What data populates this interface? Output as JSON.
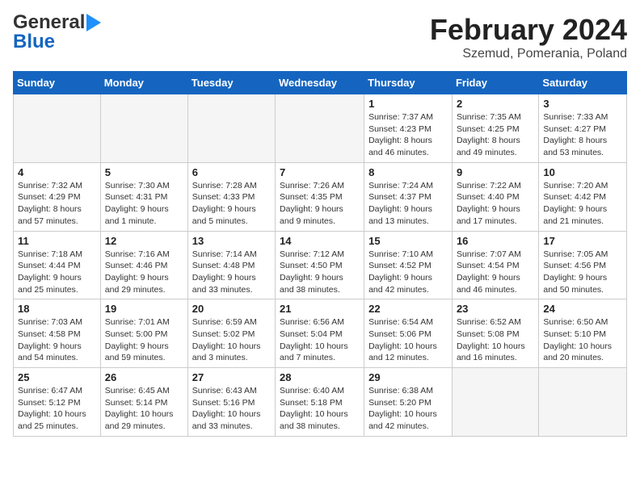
{
  "header": {
    "logo_general": "General",
    "logo_blue": "Blue",
    "month_title": "February 2024",
    "subtitle": "Szemud, Pomerania, Poland"
  },
  "days_of_week": [
    "Sunday",
    "Monday",
    "Tuesday",
    "Wednesday",
    "Thursday",
    "Friday",
    "Saturday"
  ],
  "weeks": [
    [
      {
        "day": "",
        "info": ""
      },
      {
        "day": "",
        "info": ""
      },
      {
        "day": "",
        "info": ""
      },
      {
        "day": "",
        "info": ""
      },
      {
        "day": "1",
        "info": "Sunrise: 7:37 AM\nSunset: 4:23 PM\nDaylight: 8 hours\nand 46 minutes."
      },
      {
        "day": "2",
        "info": "Sunrise: 7:35 AM\nSunset: 4:25 PM\nDaylight: 8 hours\nand 49 minutes."
      },
      {
        "day": "3",
        "info": "Sunrise: 7:33 AM\nSunset: 4:27 PM\nDaylight: 8 hours\nand 53 minutes."
      }
    ],
    [
      {
        "day": "4",
        "info": "Sunrise: 7:32 AM\nSunset: 4:29 PM\nDaylight: 8 hours\nand 57 minutes."
      },
      {
        "day": "5",
        "info": "Sunrise: 7:30 AM\nSunset: 4:31 PM\nDaylight: 9 hours\nand 1 minute."
      },
      {
        "day": "6",
        "info": "Sunrise: 7:28 AM\nSunset: 4:33 PM\nDaylight: 9 hours\nand 5 minutes."
      },
      {
        "day": "7",
        "info": "Sunrise: 7:26 AM\nSunset: 4:35 PM\nDaylight: 9 hours\nand 9 minutes."
      },
      {
        "day": "8",
        "info": "Sunrise: 7:24 AM\nSunset: 4:37 PM\nDaylight: 9 hours\nand 13 minutes."
      },
      {
        "day": "9",
        "info": "Sunrise: 7:22 AM\nSunset: 4:40 PM\nDaylight: 9 hours\nand 17 minutes."
      },
      {
        "day": "10",
        "info": "Sunrise: 7:20 AM\nSunset: 4:42 PM\nDaylight: 9 hours\nand 21 minutes."
      }
    ],
    [
      {
        "day": "11",
        "info": "Sunrise: 7:18 AM\nSunset: 4:44 PM\nDaylight: 9 hours\nand 25 minutes."
      },
      {
        "day": "12",
        "info": "Sunrise: 7:16 AM\nSunset: 4:46 PM\nDaylight: 9 hours\nand 29 minutes."
      },
      {
        "day": "13",
        "info": "Sunrise: 7:14 AM\nSunset: 4:48 PM\nDaylight: 9 hours\nand 33 minutes."
      },
      {
        "day": "14",
        "info": "Sunrise: 7:12 AM\nSunset: 4:50 PM\nDaylight: 9 hours\nand 38 minutes."
      },
      {
        "day": "15",
        "info": "Sunrise: 7:10 AM\nSunset: 4:52 PM\nDaylight: 9 hours\nand 42 minutes."
      },
      {
        "day": "16",
        "info": "Sunrise: 7:07 AM\nSunset: 4:54 PM\nDaylight: 9 hours\nand 46 minutes."
      },
      {
        "day": "17",
        "info": "Sunrise: 7:05 AM\nSunset: 4:56 PM\nDaylight: 9 hours\nand 50 minutes."
      }
    ],
    [
      {
        "day": "18",
        "info": "Sunrise: 7:03 AM\nSunset: 4:58 PM\nDaylight: 9 hours\nand 54 minutes."
      },
      {
        "day": "19",
        "info": "Sunrise: 7:01 AM\nSunset: 5:00 PM\nDaylight: 9 hours\nand 59 minutes."
      },
      {
        "day": "20",
        "info": "Sunrise: 6:59 AM\nSunset: 5:02 PM\nDaylight: 10 hours\nand 3 minutes."
      },
      {
        "day": "21",
        "info": "Sunrise: 6:56 AM\nSunset: 5:04 PM\nDaylight: 10 hours\nand 7 minutes."
      },
      {
        "day": "22",
        "info": "Sunrise: 6:54 AM\nSunset: 5:06 PM\nDaylight: 10 hours\nand 12 minutes."
      },
      {
        "day": "23",
        "info": "Sunrise: 6:52 AM\nSunset: 5:08 PM\nDaylight: 10 hours\nand 16 minutes."
      },
      {
        "day": "24",
        "info": "Sunrise: 6:50 AM\nSunset: 5:10 PM\nDaylight: 10 hours\nand 20 minutes."
      }
    ],
    [
      {
        "day": "25",
        "info": "Sunrise: 6:47 AM\nSunset: 5:12 PM\nDaylight: 10 hours\nand 25 minutes."
      },
      {
        "day": "26",
        "info": "Sunrise: 6:45 AM\nSunset: 5:14 PM\nDaylight: 10 hours\nand 29 minutes."
      },
      {
        "day": "27",
        "info": "Sunrise: 6:43 AM\nSunset: 5:16 PM\nDaylight: 10 hours\nand 33 minutes."
      },
      {
        "day": "28",
        "info": "Sunrise: 6:40 AM\nSunset: 5:18 PM\nDaylight: 10 hours\nand 38 minutes."
      },
      {
        "day": "29",
        "info": "Sunrise: 6:38 AM\nSunset: 5:20 PM\nDaylight: 10 hours\nand 42 minutes."
      },
      {
        "day": "",
        "info": ""
      },
      {
        "day": "",
        "info": ""
      }
    ]
  ]
}
